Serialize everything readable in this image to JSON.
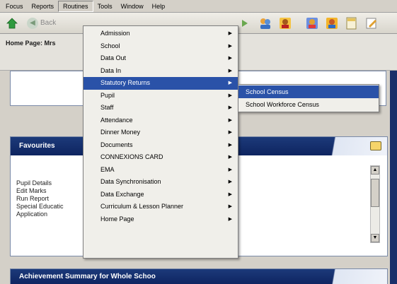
{
  "menubar": {
    "items": [
      "Focus",
      "Reports",
      "Routines",
      "Tools",
      "Window",
      "Help"
    ]
  },
  "toolbar": {
    "back_label": "Back"
  },
  "home": {
    "title": "Home Page: Mrs"
  },
  "favourites": {
    "title": "Favourites",
    "items": [
      "Pupil Details",
      "Edit Marks",
      "Run Report",
      "Special Educatic",
      "Application"
    ]
  },
  "achievement": {
    "title": "Achievement Summary for Whole Schoo"
  },
  "routines_menu": {
    "items": [
      {
        "label": "Admission",
        "submenu": true
      },
      {
        "label": "School",
        "submenu": true
      },
      {
        "label": "Data Out",
        "submenu": true
      },
      {
        "label": "Data In",
        "submenu": true
      },
      {
        "label": "Statutory Returns",
        "submenu": true
      },
      {
        "label": "Pupil",
        "submenu": true
      },
      {
        "label": "Staff",
        "submenu": true
      },
      {
        "label": "Attendance",
        "submenu": true
      },
      {
        "label": "Dinner Money",
        "submenu": true
      },
      {
        "label": "Documents",
        "submenu": true
      },
      {
        "label": "CONNEXIONS CARD",
        "submenu": true
      },
      {
        "label": "EMA",
        "submenu": true
      },
      {
        "label": "Data Synchronisation",
        "submenu": true
      },
      {
        "label": "Data Exchange",
        "submenu": true
      },
      {
        "label": "Curriculum & Lesson Planner",
        "submenu": true
      },
      {
        "label": "Home Page",
        "submenu": true
      }
    ]
  },
  "statutory_submenu": {
    "items": [
      "School Census",
      "School Workforce Census"
    ]
  },
  "colors": {
    "highlight": "#2a52a8",
    "panel_header": "#0e2460"
  }
}
